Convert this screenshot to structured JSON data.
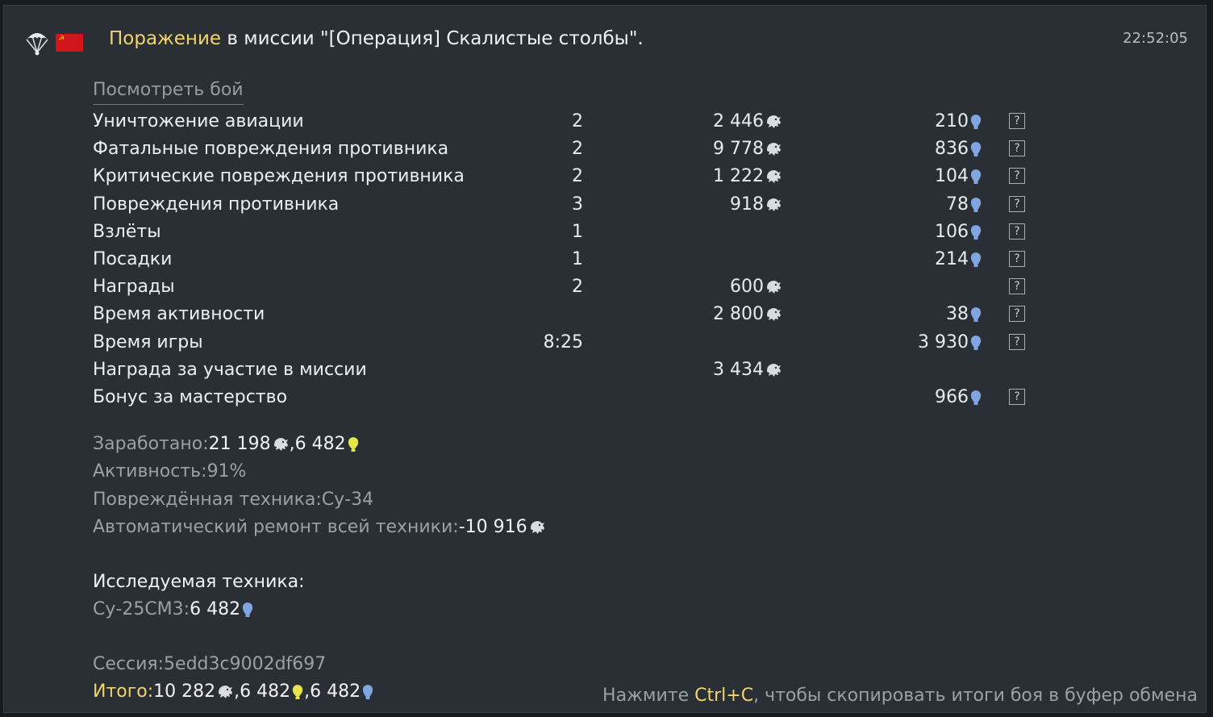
{
  "header": {
    "result": "Поражение",
    "mission_text": " в миссии \"[Операция] Скалистые столбы\".",
    "time": "22:52:05",
    "icons": [
      "parachute-icon",
      "ussr-flag-icon"
    ]
  },
  "watch_battle": "Посмотреть бой",
  "rows": [
    {
      "label": "Уничтожение авиации",
      "count": "2",
      "lions": "2 446",
      "rp": "210",
      "help": "?"
    },
    {
      "label": "Фатальные повреждения противника",
      "count": "2",
      "lions": "9 778",
      "rp": "836",
      "help": "?"
    },
    {
      "label": "Критические повреждения противника",
      "count": "2",
      "lions": "1 222",
      "rp": "104",
      "help": "?"
    },
    {
      "label": "Повреждения противника",
      "count": "3",
      "lions": "918",
      "rp": "78",
      "help": "?"
    },
    {
      "label": "Взлёты",
      "count": "1",
      "lions": "",
      "rp": "106",
      "help": "?"
    },
    {
      "label": "Посадки",
      "count": "1",
      "lions": "",
      "rp": "214",
      "help": "?"
    },
    {
      "label": "Награды",
      "count": "2",
      "lions": "600",
      "rp": "",
      "help": "?"
    },
    {
      "label": "Время активности",
      "count": "",
      "lions": "2 800",
      "rp": "38",
      "help": "?"
    },
    {
      "label": "Время игры",
      "count": "8:25",
      "lions": "",
      "rp": "3 930",
      "help": "?"
    },
    {
      "label": "Награда за участие в миссии",
      "count": "",
      "lions": "3 434",
      "rp": "",
      "help": ""
    },
    {
      "label": "Бонус за мастерство",
      "count": "",
      "lions": "",
      "rp": "966",
      "help": "?"
    }
  ],
  "summary": {
    "earned_label": "Заработано: ",
    "earned_lions": "21 198",
    "earned_sep": ", ",
    "earned_free_rp": "6 482",
    "activity_label": "Активность: ",
    "activity_value": "91%",
    "damaged_label": "Повреждённая техника: ",
    "damaged_value": "Су-34",
    "repair_label": "Автоматический ремонт всей техники: ",
    "repair_value": "-10 916"
  },
  "research": {
    "title": "Исследуемая техника:",
    "vehicle_label": "Су-25СМ3: ",
    "vehicle_rp": "6 482"
  },
  "session": {
    "label": "Сессия: ",
    "value": "5edd3c9002df697"
  },
  "total": {
    "label": "Итого: ",
    "lions": "10 282",
    "sep1": ", ",
    "free_rp": "6 482",
    "sep2": ", ",
    "rp": "6 482"
  },
  "hint": {
    "before": "Нажмите ",
    "key": "Ctrl+C",
    "after": ", чтобы скопировать итоги боя в буфер обмена"
  },
  "colors": {
    "accent": "#f4d36a",
    "rp_blue": "#7fa6e0",
    "free_rp_yellow": "#e6e64a",
    "panel": "#2a2f35"
  }
}
